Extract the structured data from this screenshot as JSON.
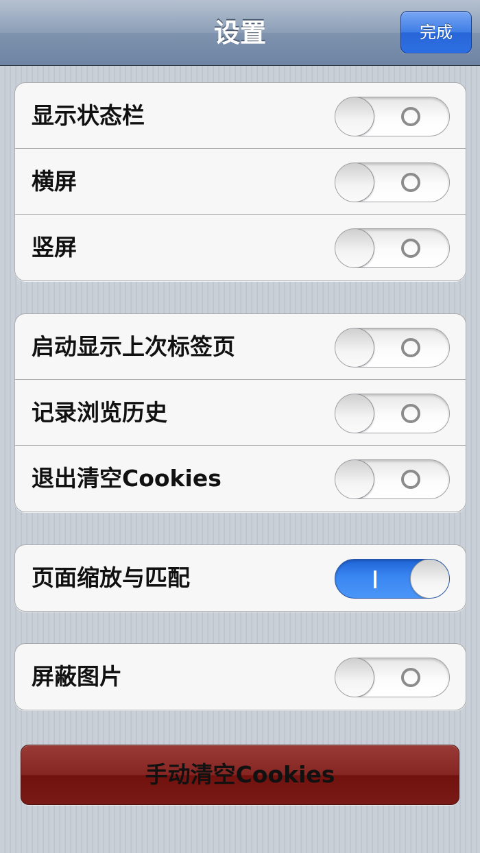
{
  "navbar": {
    "title": "设置",
    "done_label": "完成"
  },
  "groups": [
    {
      "rows": [
        {
          "label": "显示状态栏",
          "on": false
        },
        {
          "label": "横屏",
          "on": false
        },
        {
          "label": "竖屏",
          "on": false
        }
      ]
    },
    {
      "rows": [
        {
          "label": "启动显示上次标签页",
          "on": false
        },
        {
          "label": "记录浏览历史",
          "on": false
        },
        {
          "label": "退出清空Cookies",
          "on": false
        }
      ]
    },
    {
      "rows": [
        {
          "label": "页面缩放与匹配",
          "on": true
        }
      ]
    },
    {
      "rows": [
        {
          "label": "屏蔽图片",
          "on": false
        }
      ]
    }
  ],
  "clear_button": {
    "label": "手动清空Cookies"
  },
  "colors": {
    "toggle_on": "#3a87f2",
    "clear_button": "#7a1a16",
    "done_button": "#2d6fe2"
  }
}
